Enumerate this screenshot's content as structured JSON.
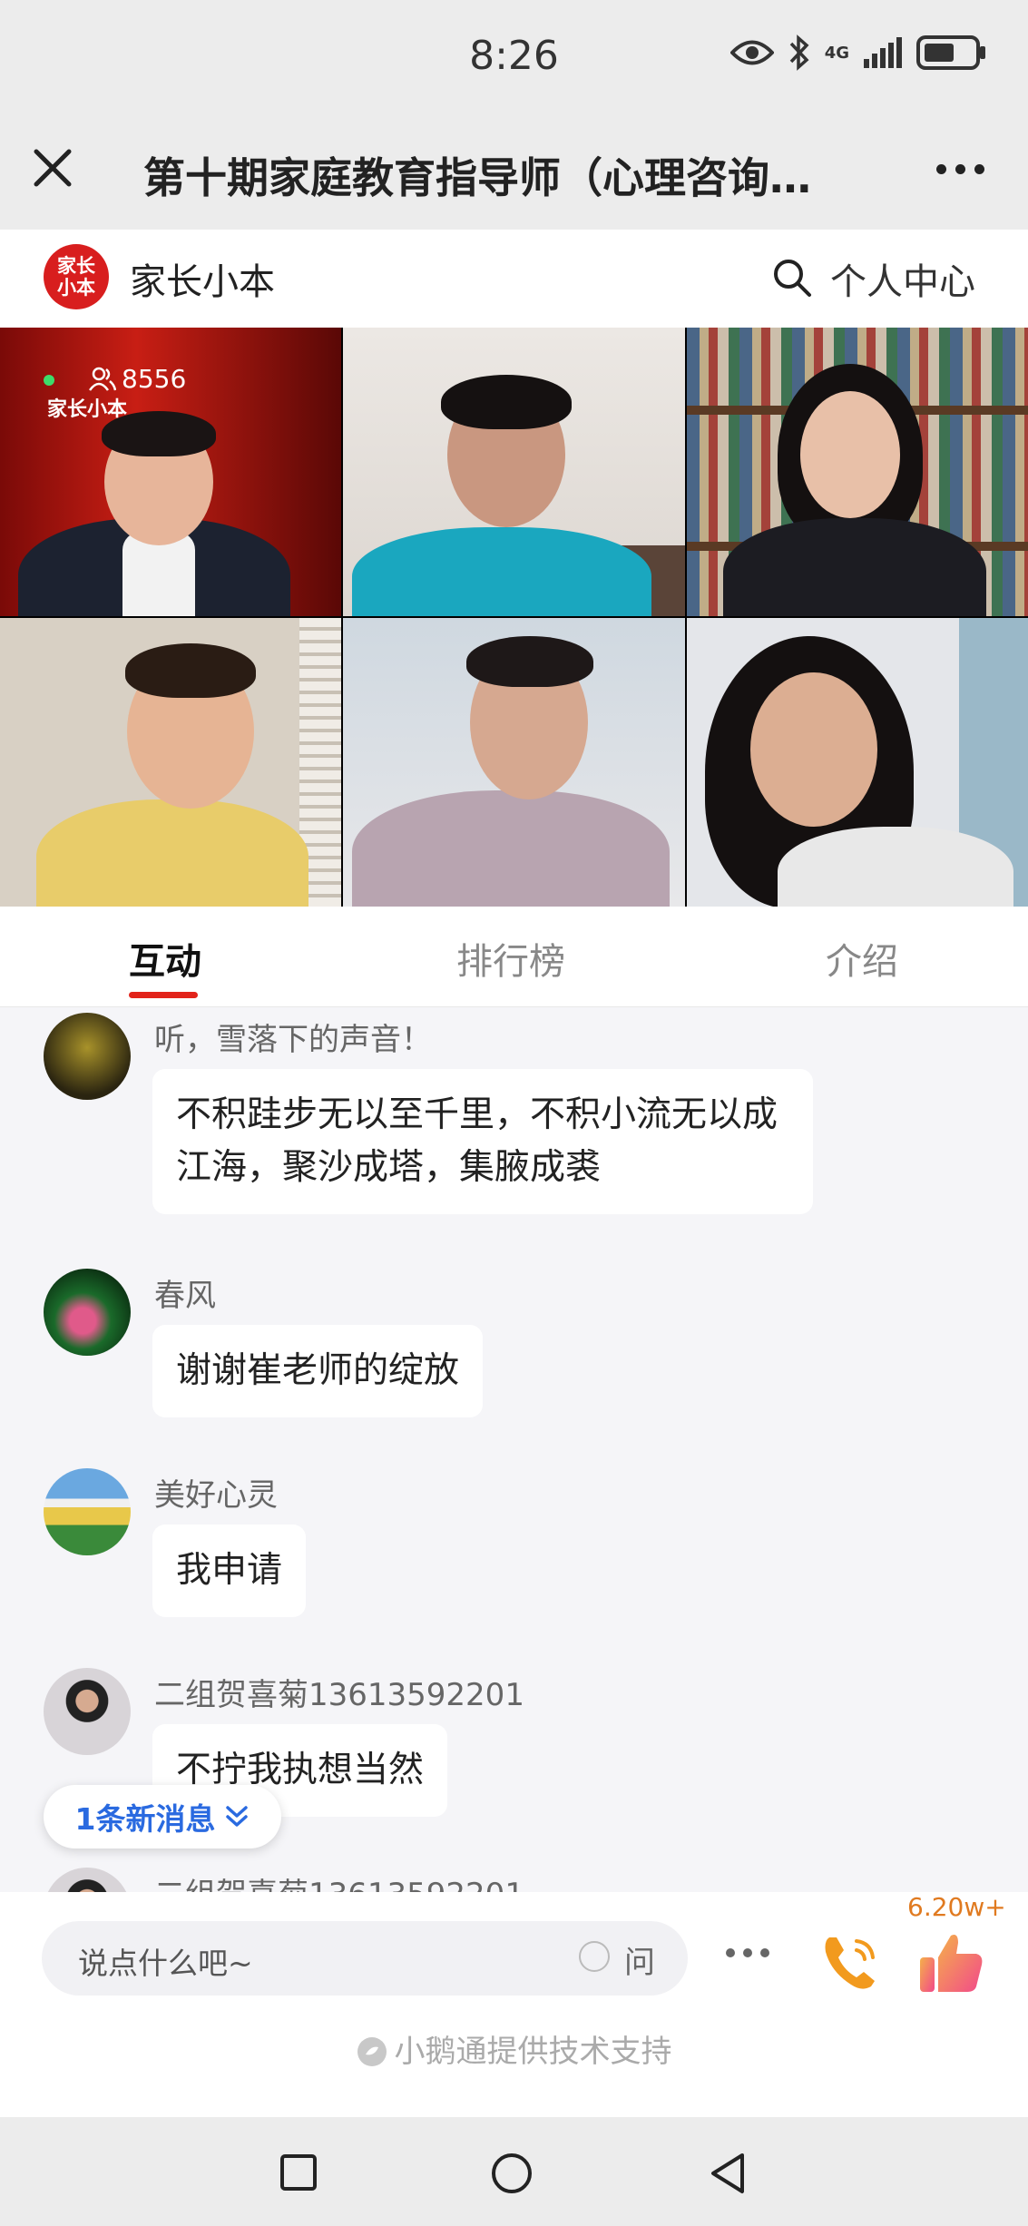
{
  "status_bar": {
    "time": "8:26",
    "network": "4G"
  },
  "header": {
    "title": "第十期家庭教育指导师（心理咨询…"
  },
  "brand": {
    "logo_text": "家长小本",
    "name": "家长小本",
    "personal_center": "个人中心"
  },
  "video": {
    "viewer_count": "8556",
    "watermark": "家长小本"
  },
  "tabs": [
    "互动",
    "排行榜",
    "介绍"
  ],
  "messages": [
    {
      "user": "听，雪落下的声音！",
      "text": "不积跬步无以至千里，不积小流无以成江海，聚沙成塔，集腋成裘"
    },
    {
      "user": "春风",
      "text": "谢谢崔老师的绽放"
    },
    {
      "user": "美好心灵",
      "text": "我申请"
    },
    {
      "user": "二组贺喜菊13613592201",
      "text": "不拧我执想当然"
    },
    {
      "user": "二组贺喜菊13613592201",
      "text": ""
    }
  ],
  "new_messages": "1条新消息",
  "input": {
    "placeholder": "说点什么吧~",
    "ask_label": "问"
  },
  "likes": "6.20w+",
  "support": "小鹅通提供技术支持",
  "colors": {
    "accent": "#e2231a",
    "link": "#2a6ae0",
    "likes": "#e07a20"
  }
}
